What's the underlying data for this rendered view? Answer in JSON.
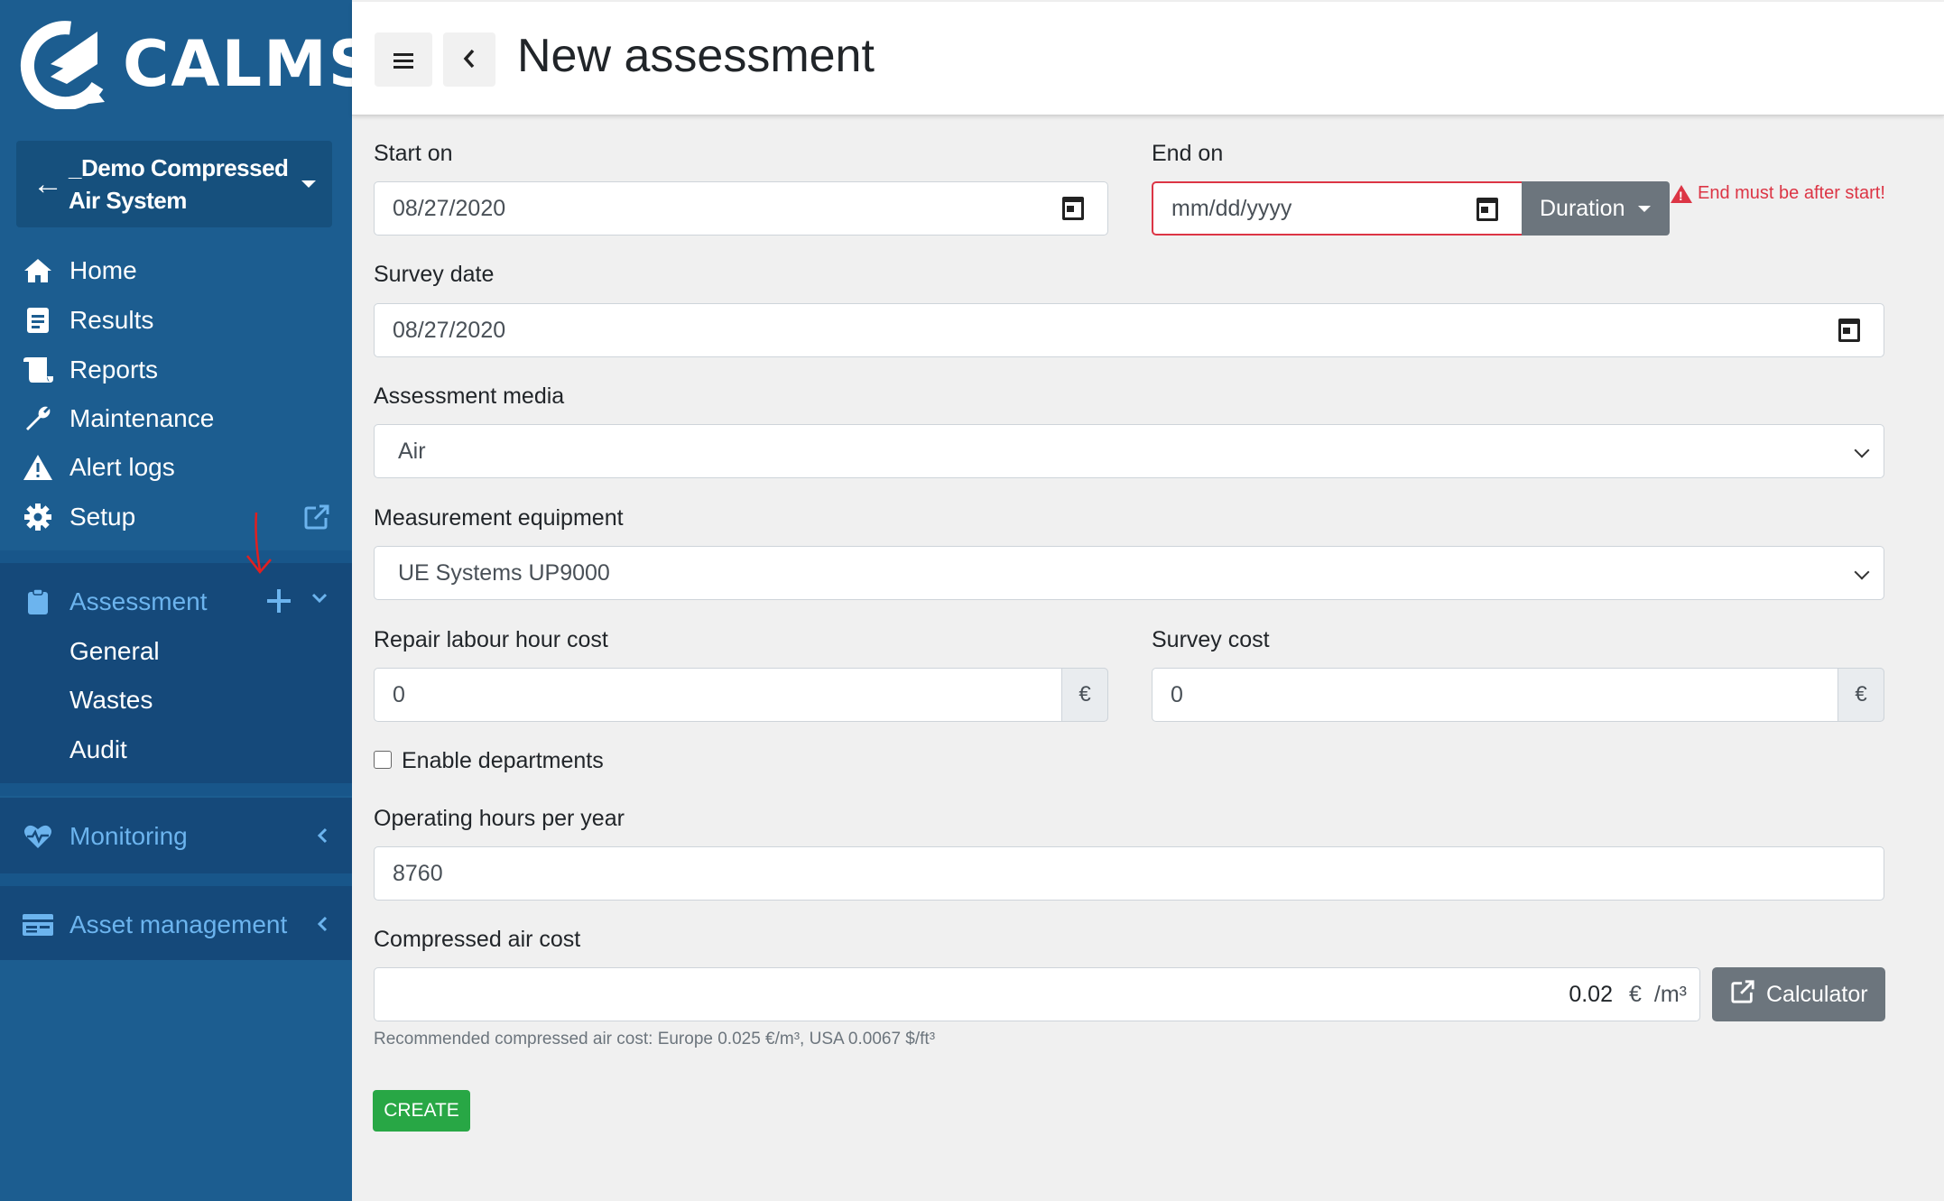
{
  "brand": {
    "name": "CALMS"
  },
  "project": {
    "name_line1": "_Demo Compressed",
    "name_line2": "Air System"
  },
  "nav": {
    "home": "Home",
    "results": "Results",
    "reports": "Reports",
    "maintenance": "Maintenance",
    "alert_logs": "Alert logs",
    "setup": "Setup"
  },
  "assessment": {
    "label": "Assessment",
    "items": [
      "General",
      "Wastes",
      "Audit"
    ]
  },
  "monitoring": {
    "label": "Monitoring"
  },
  "asset_management": {
    "label": "Asset management"
  },
  "header": {
    "title": "New assessment"
  },
  "form": {
    "start_on": {
      "label": "Start on",
      "value": "08/27/2020"
    },
    "end_on": {
      "label": "End on",
      "placeholder": "mm/dd/yyyy",
      "duration_label": "Duration",
      "error": "End must be after start!"
    },
    "survey_date": {
      "label": "Survey date",
      "value": "08/27/2020"
    },
    "assessment_media": {
      "label": "Assessment media",
      "value": "Air"
    },
    "measurement_equipment": {
      "label": "Measurement equipment",
      "value": "UE Systems UP9000"
    },
    "repair_labour_hour_cost": {
      "label": "Repair labour hour cost",
      "value": "0",
      "unit": "€"
    },
    "survey_cost": {
      "label": "Survey cost",
      "value": "0",
      "unit": "€"
    },
    "enable_departments": {
      "label": "Enable departments",
      "checked": false
    },
    "operating_hours": {
      "label": "Operating hours per year",
      "value": "8760"
    },
    "compressed_air_cost": {
      "label": "Compressed air cost",
      "value": "0.02",
      "currency": "€",
      "unit": "/m³",
      "calculator_label": "Calculator",
      "hint": "Recommended compressed air cost: Europe 0.025 €/m³, USA 0.0067 $/ft³"
    },
    "create_label": "CREATE"
  },
  "colors": {
    "sidebar": "#1c5d90",
    "accent": "#6cb4ee",
    "danger": "#dc3545",
    "success": "#28a745",
    "secondary": "#6c757d"
  }
}
